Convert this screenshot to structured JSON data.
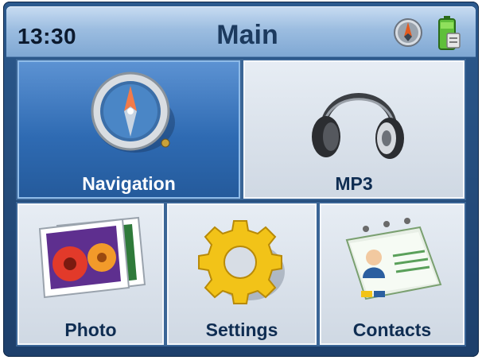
{
  "header": {
    "time": "13:30",
    "title": "Main",
    "icons": [
      "compass-indicator-icon",
      "battery-icon"
    ]
  },
  "tiles": [
    {
      "label": "Navigation",
      "icon": "compass-icon",
      "selected": true
    },
    {
      "label": "MP3",
      "icon": "headphones-icon",
      "selected": false
    },
    {
      "label": "Photo",
      "icon": "photo-icon",
      "selected": false
    },
    {
      "label": "Settings",
      "icon": "gear-icon",
      "selected": false
    },
    {
      "label": "Contacts",
      "icon": "contacts-icon",
      "selected": false
    }
  ],
  "colors": {
    "frame": "#2c5a8e",
    "selected_tile": "#2f6bb3",
    "tile": "#dfe6ee",
    "label_text": "#0f2d52"
  }
}
